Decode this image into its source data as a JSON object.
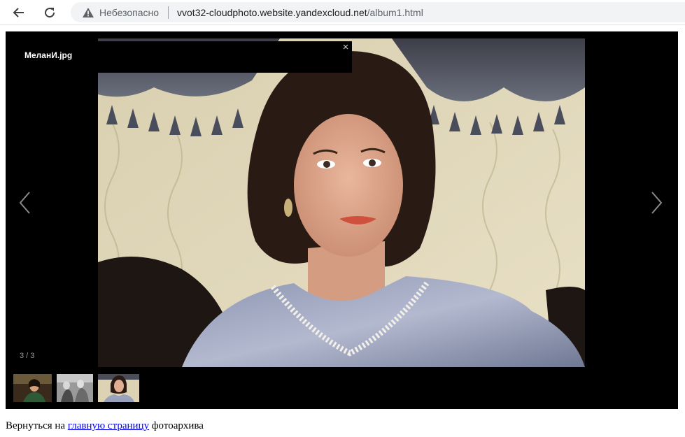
{
  "browser": {
    "back_icon": "arrow-left-icon",
    "reload_icon": "reload-icon",
    "security_icon": "warning-triangle-icon",
    "security_label": "Небезопасно",
    "url_host": "vvot32-cloudphoto.website.yandexcloud.net",
    "url_path": "/album1.html"
  },
  "gallery": {
    "caption": "МеланИ.jpg",
    "close_symbol": "×",
    "prev_icon": "chevron-left-icon",
    "next_icon": "chevron-right-icon",
    "counter": "3 / 3",
    "thumbnails": [
      "thumbnail-1",
      "thumbnail-2",
      "thumbnail-3"
    ],
    "active_thumbnail": 3
  },
  "footer": {
    "prefix": "Вернуться на ",
    "link_text": "главную страницу",
    "suffix": " фотоархива"
  },
  "colors": {
    "viewer_bg": "#000000",
    "link": "#0000ee"
  }
}
